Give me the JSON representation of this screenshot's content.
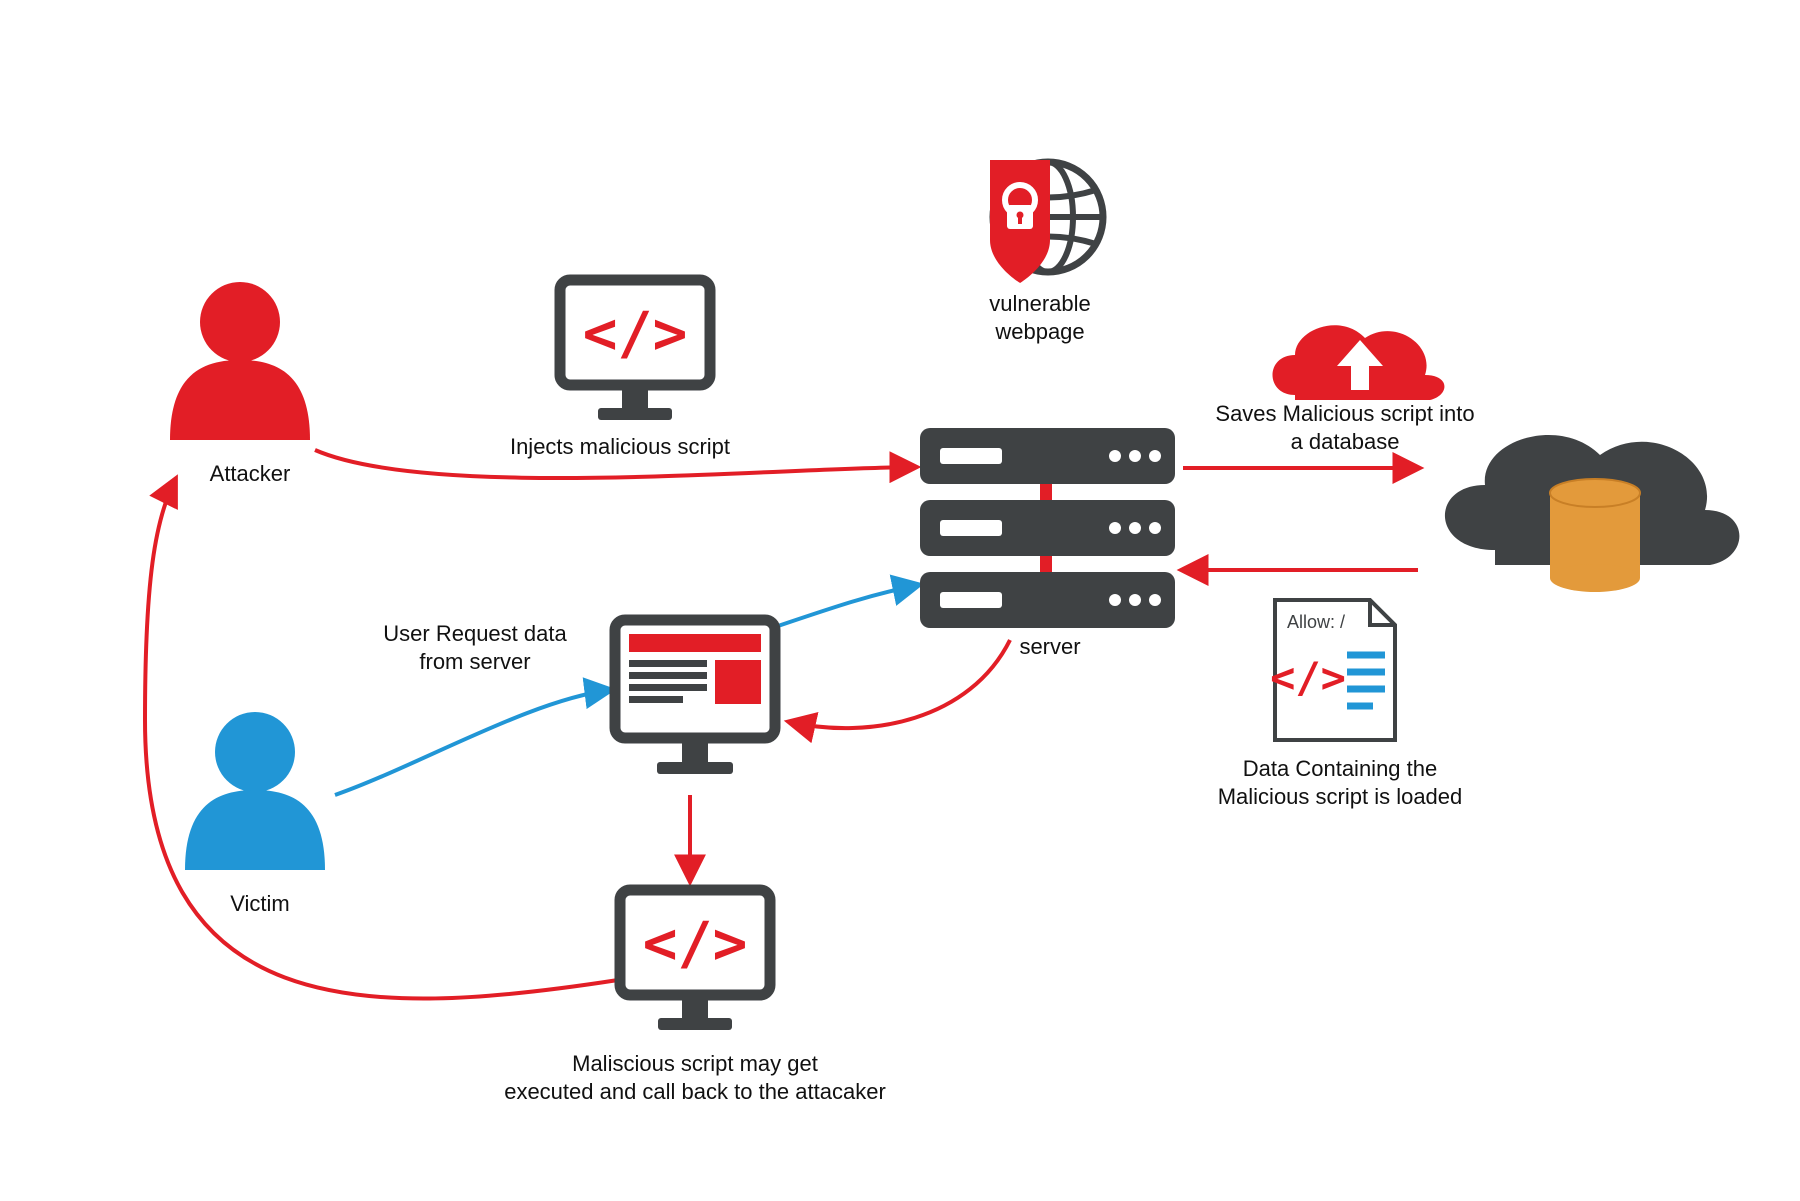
{
  "colors": {
    "red": "#e21e26",
    "blue": "#2196d6",
    "dark": "#3f4244",
    "orange": "#e39a3b",
    "white": "#ffffff",
    "text": "#111111"
  },
  "nodes": {
    "attacker": {
      "label": "Attacker"
    },
    "victim": {
      "label": "Victim"
    },
    "server": {
      "label": "server"
    },
    "vuln_webpage": {
      "label": "vulnerable\nwebpage"
    },
    "script_doc": {
      "allow_text": "Allow: /"
    }
  },
  "edges": {
    "inject": {
      "label": "Injects malicious script"
    },
    "save_db": {
      "label": "Saves Malicious script into\na database"
    },
    "load_script": {
      "label": "Data Containing the\nMalicious script is loaded"
    },
    "user_request": {
      "label": "User Request data\nfrom server"
    },
    "exec_callback": {
      "label": "Maliscious script may get\nexecuted and call back to the attacaker"
    }
  }
}
